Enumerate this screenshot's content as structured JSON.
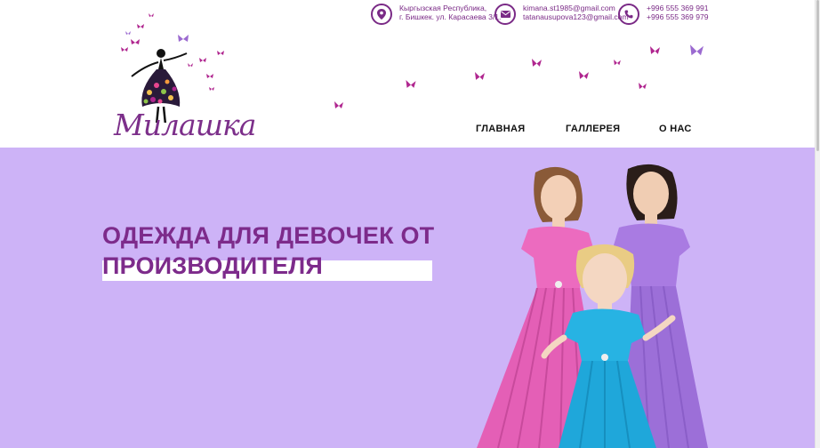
{
  "brand": {
    "logo_text": "Милашка"
  },
  "contacts": {
    "address": {
      "line1": "Кыргызская Республика,",
      "line2": "г. Бишкек. ул. Карасаева 3/1."
    },
    "email": {
      "line1": "kimana.st1985@gmail.com",
      "line2": "tatanausupova123@gmail.com"
    },
    "phone": {
      "line1": "+996 555 369 991",
      "line2": "+996 555 369 979"
    }
  },
  "nav": {
    "home": "ГЛАВНАЯ",
    "gallery": "ГАЛЛЕРЕЯ",
    "about": "О НАС"
  },
  "hero": {
    "title_line1": "ОДЕЖДА ДЛЯ ДЕВОЧЕК ОТ",
    "title_line2": "ПРОИЗВОДИТЕЛЯ"
  },
  "colors": {
    "brand_purple": "#7d2b8b",
    "hero_background": "#cdb3f7",
    "butterfly_magenta": "#b0268f",
    "butterfly_lilac": "#9b6ad0",
    "dress_pink": "#ec6bbf",
    "dress_blue": "#27b3e3",
    "dress_lilac": "#a97be2"
  },
  "icons": {
    "address": "map-pin-icon",
    "email": "envelope-icon",
    "phone": "phone-icon",
    "decor": "butterfly-icon"
  }
}
